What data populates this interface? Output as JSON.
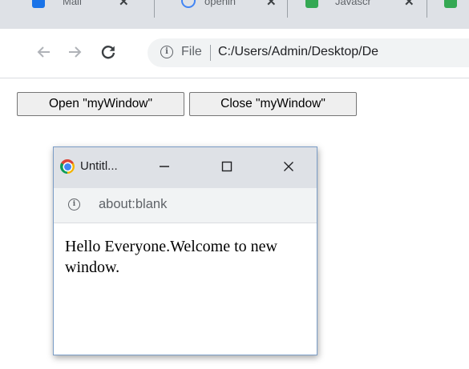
{
  "browser": {
    "tabs": [
      {
        "title": "Mail",
        "favicon_color": "#1a73e8"
      },
      {
        "title": "openin",
        "favicon_color": "#4285f4"
      },
      {
        "title": "Javascr",
        "favicon_color": "#34a853"
      },
      {
        "title": "",
        "favicon_color": "#34a853"
      }
    ],
    "address": {
      "scheme_label": "File",
      "url": "C:/Users/Admin/Desktop/De"
    },
    "accent_color": "#1a73e8"
  },
  "page": {
    "buttons": {
      "open_label": "Open \"myWindow\"",
      "close_label": "Close \"myWindow\""
    }
  },
  "popup": {
    "title": "Untitl...",
    "url": "about:blank",
    "content": "Hello Everyone.Welcome to new window.",
    "border_color": "#7a9cc6"
  },
  "icons": {
    "info_glyph": "i"
  }
}
